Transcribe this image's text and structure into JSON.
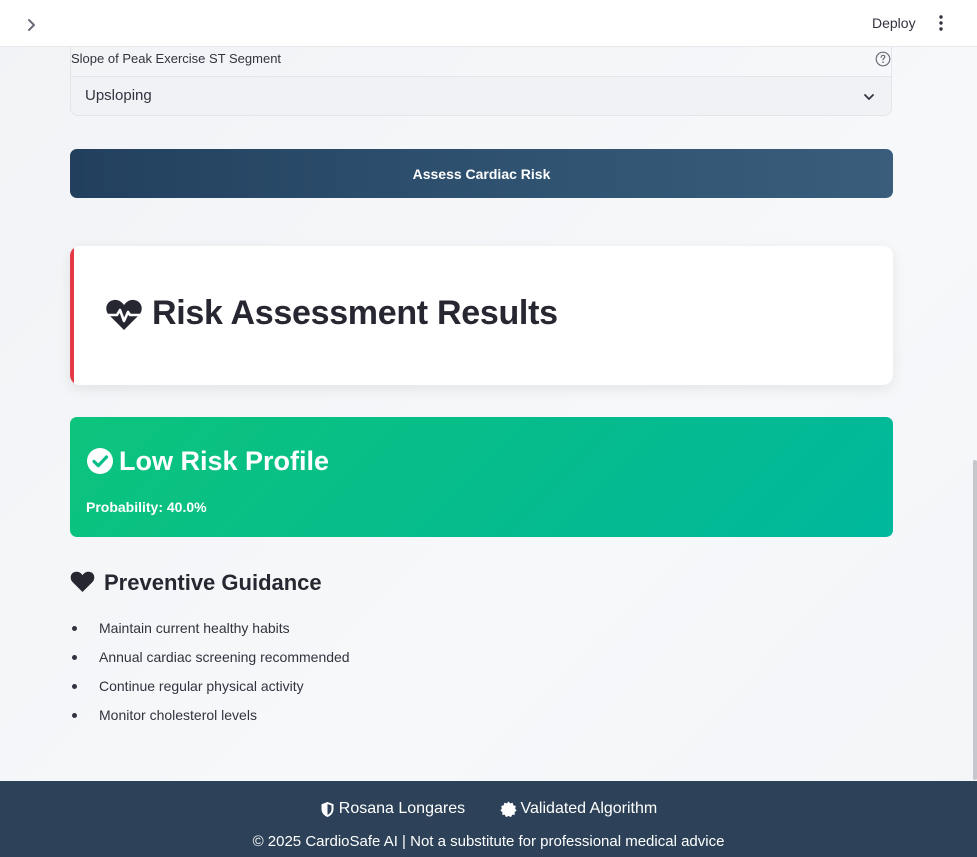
{
  "header": {
    "deploy_label": "Deploy"
  },
  "form": {
    "slope_label": "Slope of Peak Exercise ST Segment",
    "slope_value": "Upsloping",
    "submit_label": "Assess Cardiac Risk"
  },
  "results": {
    "title": "Risk Assessment Results",
    "accent_color": "#e63946",
    "icon": "heart-pulse-icon"
  },
  "risk": {
    "title": "Low Risk Profile",
    "probability_text": "Probability: 40.0%",
    "probability": 0.4,
    "color": "#05bb8f",
    "icon": "check-circle-icon"
  },
  "guidance": {
    "title": "Preventive Guidance",
    "icon": "heart-icon",
    "items": [
      "Maintain current healthy habits",
      "Annual cardiac screening recommended",
      "Continue regular physical activity",
      "Monitor cholesterol levels"
    ]
  },
  "footer": {
    "author": "Rosana Longares",
    "badge": "Validated Algorithm",
    "copyright": "© 2025 CardioSafe AI | Not a substitute for professional medical advice",
    "background": "#2d4258"
  }
}
